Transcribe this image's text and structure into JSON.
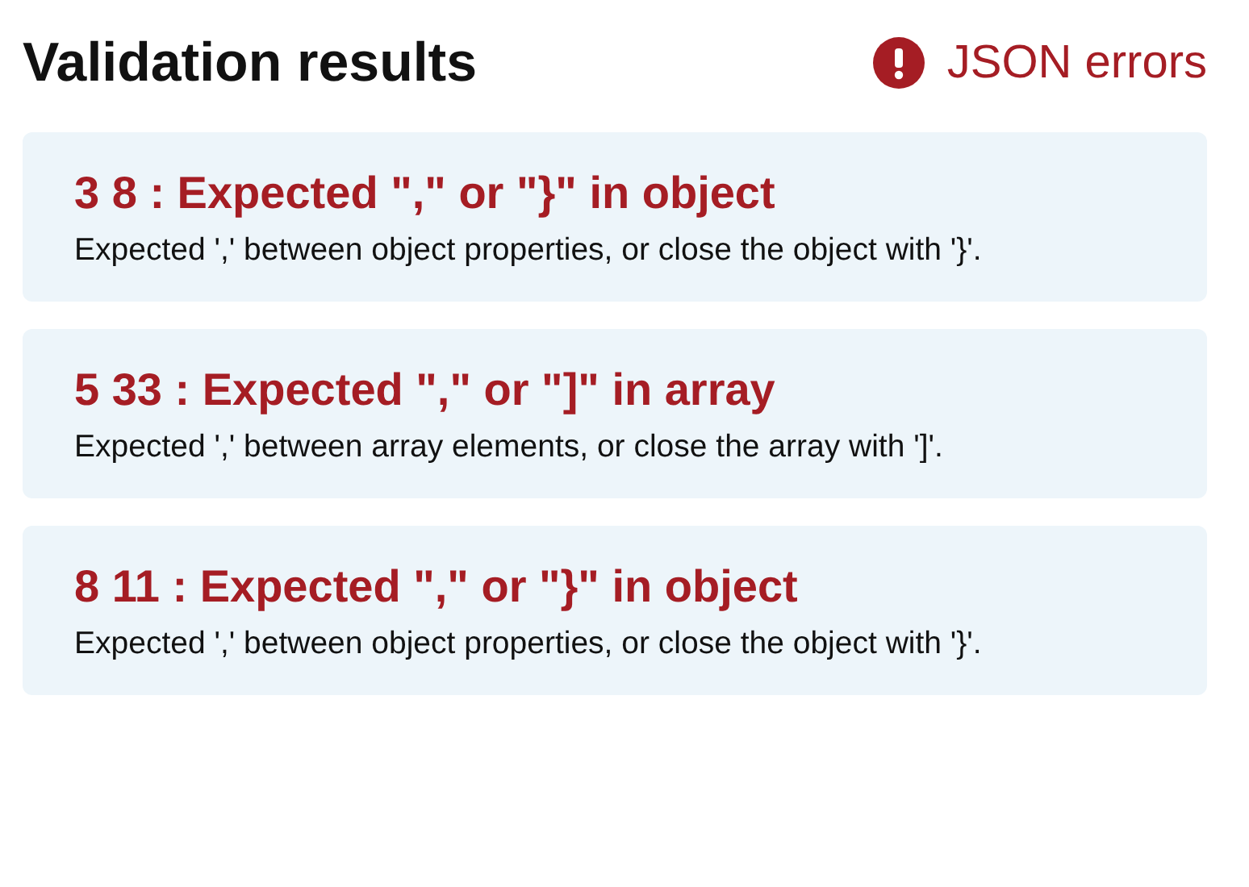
{
  "header": {
    "title": "Validation results",
    "status": "JSON errors"
  },
  "errors": [
    {
      "title": "3 8 : Expected \",\" or \"}\" in object",
      "message": "Expected ',' between object properties, or close the object with '}'."
    },
    {
      "title": "5 33 : Expected \",\" or \"]\" in array",
      "message": "Expected ',' between array elements, or close the array with ']'."
    },
    {
      "title": "8 11 : Expected \",\" or \"}\" in object",
      "message": "Expected ',' between object properties, or close the object with '}'."
    }
  ]
}
